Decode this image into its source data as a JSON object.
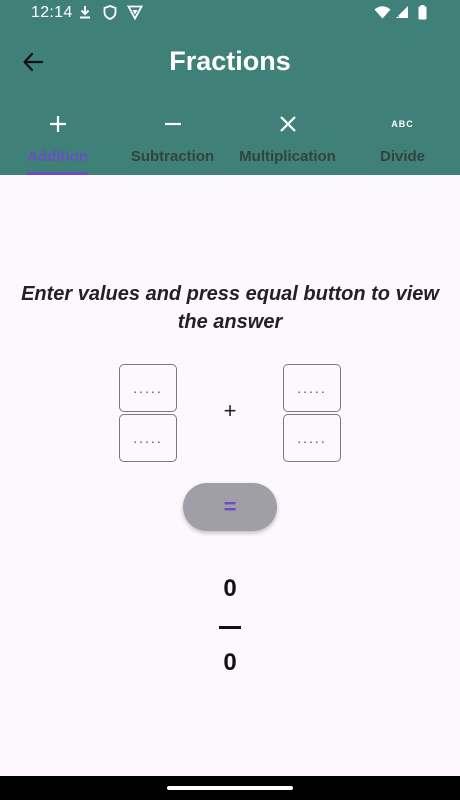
{
  "status_bar": {
    "time": "12:14",
    "icons": [
      "download-icon",
      "shield-icon",
      "vpn-icon",
      "wifi-icon",
      "signal-icon",
      "battery-icon"
    ]
  },
  "app_bar": {
    "title": "Fractions",
    "back_icon": "arrow-back-icon"
  },
  "tabs": [
    {
      "label": "Addition",
      "icon": "plus-icon",
      "active": true
    },
    {
      "label": "Subtraction",
      "icon": "minus-icon",
      "active": false
    },
    {
      "label": "Multiplication",
      "icon": "times-icon",
      "active": false
    },
    {
      "label": "Divide",
      "icon": "abc-icon",
      "active": false
    }
  ],
  "abc_glyph": "ABC",
  "main": {
    "instruction": "Enter values and press equal button to view the answer",
    "operator": "+",
    "first_fraction": {
      "numerator_placeholder": ".....",
      "denominator_placeholder": "....."
    },
    "second_fraction": {
      "numerator_placeholder": ".....",
      "denominator_placeholder": "....."
    },
    "equals_label": "=",
    "result": {
      "numerator": "0",
      "denominator": "0"
    }
  },
  "colors": {
    "header": "#3f8178",
    "accent": "#6a4fc2",
    "background": "#fdf8fd",
    "equals_button": "#a09fa7"
  }
}
